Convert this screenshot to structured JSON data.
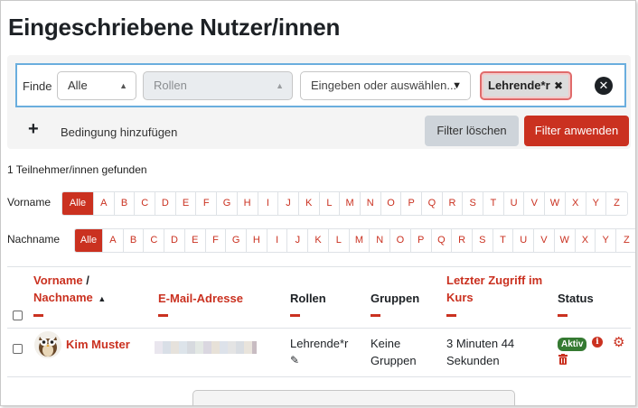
{
  "page_title": "Eingeschriebene Nutzer/innen",
  "filter": {
    "finde_label": "Finde",
    "match_select": "Alle",
    "type_select": "Rollen",
    "value_placeholder": "Eingeben oder auswählen...",
    "chip_label": "Lehrende*r",
    "chip_remove": "✖",
    "add_condition_label": "Bedingung hinzufügen",
    "clear_button": "Filter löschen",
    "apply_button": "Filter anwenden"
  },
  "count_text": "1 Teilnehmer/innen gefunden",
  "firstname_bar": {
    "label": "Vorname",
    "letters": [
      "Alle",
      "A",
      "B",
      "C",
      "D",
      "E",
      "F",
      "G",
      "H",
      "I",
      "J",
      "K",
      "L",
      "M",
      "N",
      "O",
      "P",
      "Q",
      "R",
      "S",
      "T",
      "U",
      "V",
      "W",
      "X",
      "Y",
      "Z"
    ]
  },
  "lastname_bar": {
    "label": "Nachname",
    "letters": [
      "Alle",
      "A",
      "B",
      "C",
      "D",
      "E",
      "F",
      "G",
      "H",
      "I",
      "J",
      "K",
      "L",
      "M",
      "N",
      "O",
      "P",
      "Q",
      "R",
      "S",
      "T",
      "U",
      "V",
      "W",
      "X",
      "Y",
      "Z"
    ]
  },
  "table": {
    "headers": {
      "firstname": "Vorname",
      "slash": "/",
      "lastname": "Nachname",
      "sort_icon": "▲",
      "email": "E-Mail-Adresse",
      "roles": "Rollen",
      "groups": "Gruppen",
      "last_access_1": "Letzter Zugriff im",
      "last_access_2": "Kurs",
      "status": "Status"
    },
    "rows": [
      {
        "name": "Kim Muster",
        "role": "Lehrende*r",
        "groups_1": "Keine",
        "groups_2": "Gruppen",
        "last_access_1": "3 Minuten 44",
        "last_access_2": "Sekunden",
        "status": "Aktiv"
      }
    ]
  },
  "colors": {
    "accent": "#ca3120",
    "filter_border": "#6aaede",
    "badge": "#357a32"
  }
}
